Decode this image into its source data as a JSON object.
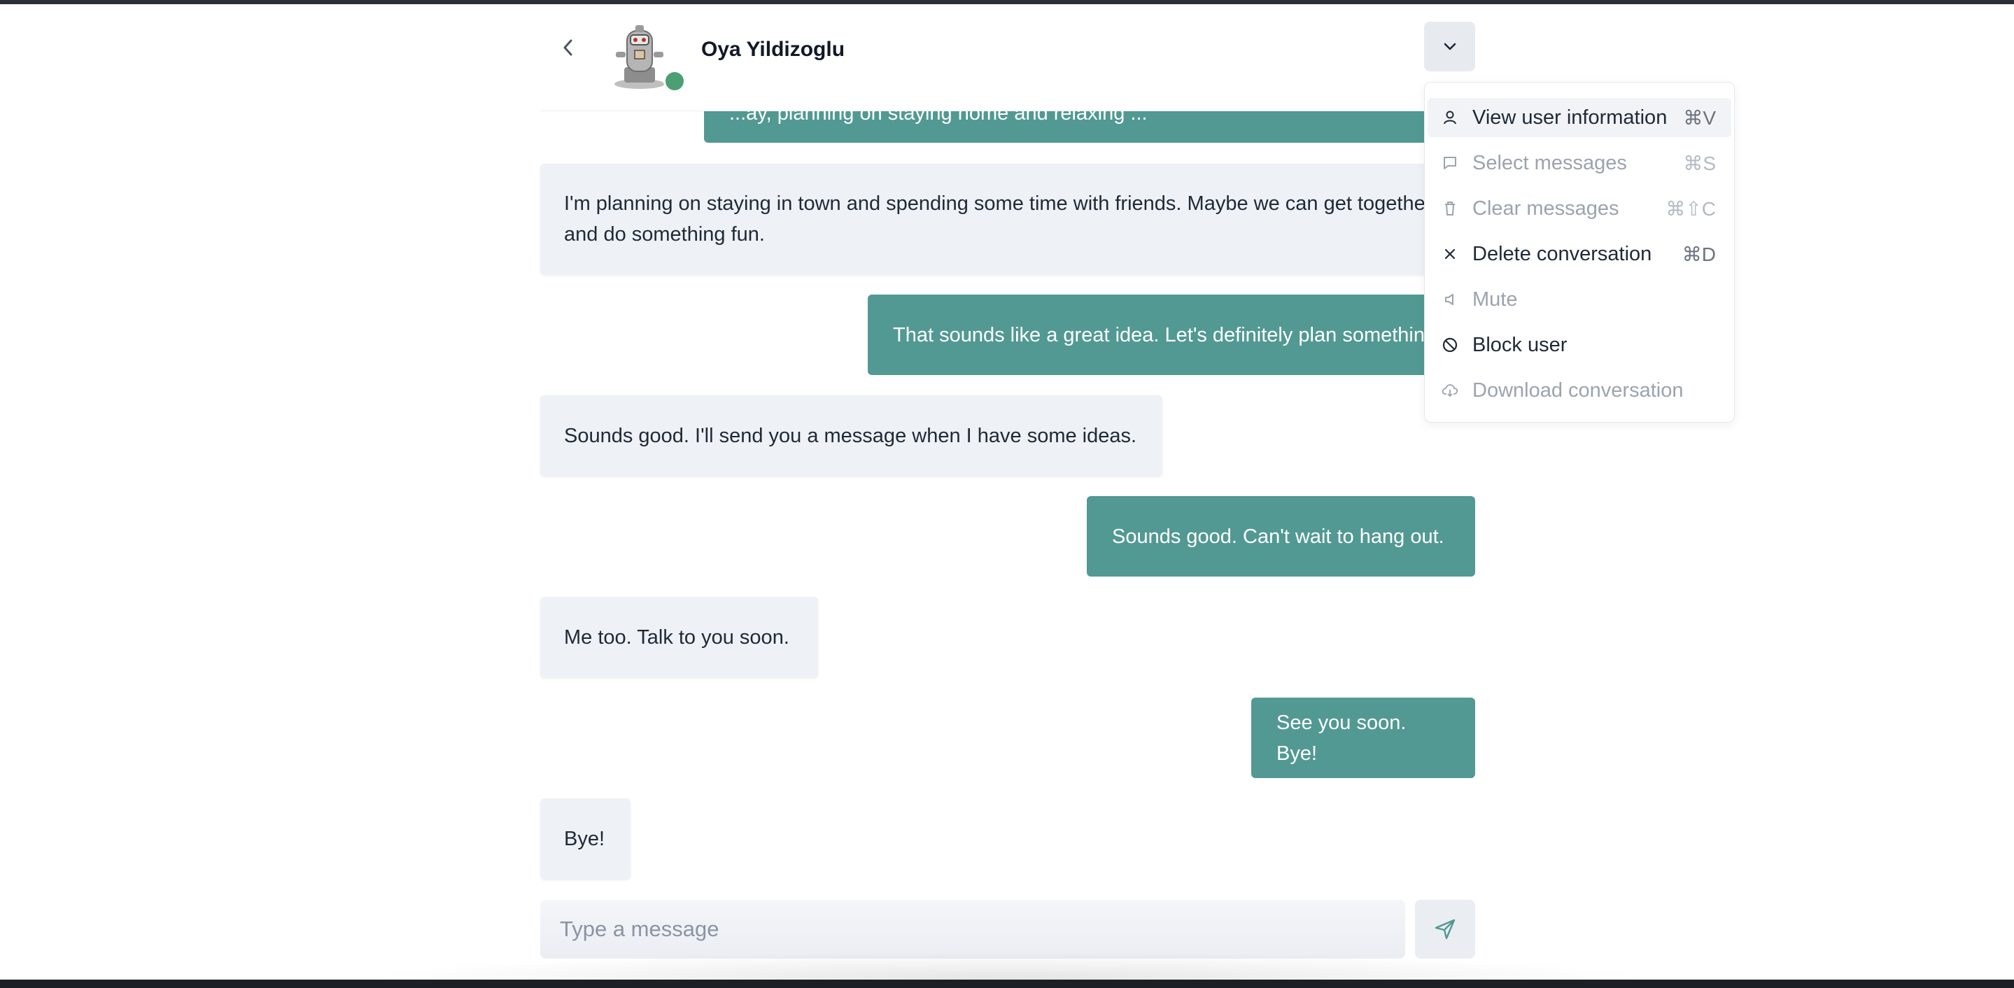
{
  "header": {
    "contact_name": "Oya Yildizoglu",
    "status": "online",
    "status_color": "#4c9f72"
  },
  "messages": [
    {
      "from": "me",
      "text": "...ay, planning on staying home and relaxing ..."
    },
    {
      "from": "them",
      "text": "I'm planning on staying in town and spending some time with friends. Maybe we can get together and do something fun."
    },
    {
      "from": "me",
      "text": "That sounds like a great idea. Let's definitely plan something."
    },
    {
      "from": "them",
      "text": "Sounds good. I'll send you a message when I have some ideas."
    },
    {
      "from": "me",
      "text": "Sounds good. Can't wait to hang out."
    },
    {
      "from": "them",
      "text": "Me too. Talk to you soon."
    },
    {
      "from": "me",
      "text": "See you soon. Bye!"
    },
    {
      "from": "them",
      "text": "Bye!"
    }
  ],
  "composer": {
    "placeholder": "Type a message"
  },
  "menu": {
    "items": [
      {
        "label": "View user information",
        "shortcut": "⌘V",
        "icon": "user-icon",
        "enabled": true,
        "highlighted": true
      },
      {
        "label": "Select messages",
        "shortcut": "⌘S",
        "icon": "message-icon",
        "enabled": false
      },
      {
        "label": "Clear messages",
        "shortcut": "⌘⇧C",
        "icon": "trash-icon",
        "enabled": false
      },
      {
        "label": "Delete conversation",
        "shortcut": "⌘D",
        "icon": "x-icon",
        "enabled": true
      },
      {
        "label": "Mute",
        "shortcut": "",
        "icon": "speaker-icon",
        "enabled": false
      },
      {
        "label": "Block user",
        "shortcut": "",
        "icon": "block-icon",
        "enabled": true
      },
      {
        "label": "Download conversation",
        "shortcut": "",
        "icon": "cloud-download-icon",
        "enabled": false
      }
    ]
  },
  "colors": {
    "accent": "#529993",
    "incoming_bubble": "#eef1f5"
  }
}
